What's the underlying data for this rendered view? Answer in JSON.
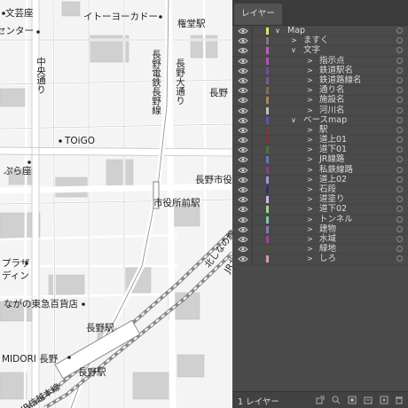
{
  "map": {
    "labels": {
      "bunkaza": "文芸座",
      "center": "センター",
      "itoyokado": "イトーヨーカドー",
      "gondo_station": "権堂駅",
      "chuo_dori": "中央通り",
      "nagano_dentetsu": "長野電鉄長野線",
      "nagano_odori": "長野大通り",
      "nagano_right": "長野",
      "toigo": "TOiGO",
      "burakuza": "ぷら座",
      "nagano_shi": "長野市役",
      "shiyakusho_mae": "市役所前駅",
      "kita_shinano": "北しなの線",
      "jr_label": "JR北",
      "plaza": "プラザ",
      "dein": "ディン",
      "tokyu": "ながの東急百貨店",
      "nagano_station": "長野駅",
      "midori": "MIDORI 長野",
      "nagano_station2": "長野駅",
      "shinetsu": "JR信越本線"
    }
  },
  "panel": {
    "tab_label": "レイヤー",
    "footer_count": "1 レイヤー",
    "layers": [
      {
        "name": "Map",
        "color": "#e8e05a",
        "indent": 0,
        "arrow": "∨"
      },
      {
        "name": "ますく",
        "color": "#7a7a7a",
        "indent": 1,
        "arrow": ">"
      },
      {
        "name": "文字",
        "color": "#d24fd0",
        "indent": 1,
        "arrow": "∨"
      },
      {
        "name": "指示点",
        "color": "#c246c7",
        "indent": 2,
        "arrow": ">"
      },
      {
        "name": "鉄道駅名",
        "color": "#6b4f9e",
        "indent": 2,
        "arrow": ">"
      },
      {
        "name": "鉄道路線名",
        "color": "#7a5a86",
        "indent": 2,
        "arrow": ">"
      },
      {
        "name": "通り名",
        "color": "#8c6a4a",
        "indent": 2,
        "arrow": ">"
      },
      {
        "name": "施設名",
        "color": "#b08454",
        "indent": 2,
        "arrow": ">"
      },
      {
        "name": "河川名",
        "color": "#c9bfb0",
        "indent": 2,
        "arrow": ">"
      },
      {
        "name": "ベースmap",
        "color": "#5d4fc4",
        "indent": 1,
        "arrow": "∨"
      },
      {
        "name": "駅",
        "color": "#7a3b3b",
        "indent": 2,
        "arrow": ">"
      },
      {
        "name": "道上01",
        "color": "#8a2f2f",
        "indent": 2,
        "arrow": ">"
      },
      {
        "name": "道下01",
        "color": "#3b7a42",
        "indent": 2,
        "arrow": ">"
      },
      {
        "name": "JR線路",
        "color": "#6a6fd2",
        "indent": 2,
        "arrow": ">"
      },
      {
        "name": "私鉄線路",
        "color": "#8a3a8a",
        "indent": 2,
        "arrow": ">"
      },
      {
        "name": "道上02",
        "color": "#9a9ae0",
        "indent": 2,
        "arrow": ">"
      },
      {
        "name": "石段",
        "color": "#2a2e7a",
        "indent": 2,
        "arrow": ">"
      },
      {
        "name": "道塗り",
        "color": "#c7b8e8",
        "indent": 2,
        "arrow": ">"
      },
      {
        "name": "道下02",
        "color": "#8fe07a",
        "indent": 2,
        "arrow": ">"
      },
      {
        "name": "トンネル",
        "color": "#6fd29a",
        "indent": 2,
        "arrow": ">"
      },
      {
        "name": "建物",
        "color": "#8a6fd2",
        "indent": 2,
        "arrow": ">"
      },
      {
        "name": "水域",
        "color": "#b23a8a",
        "indent": 2,
        "arrow": ">"
      },
      {
        "name": "緑地",
        "color": "#5a4a2a",
        "indent": 2,
        "arrow": ">"
      },
      {
        "name": "しろ",
        "color": "#e09a9a",
        "indent": 2,
        "arrow": ">"
      }
    ]
  }
}
